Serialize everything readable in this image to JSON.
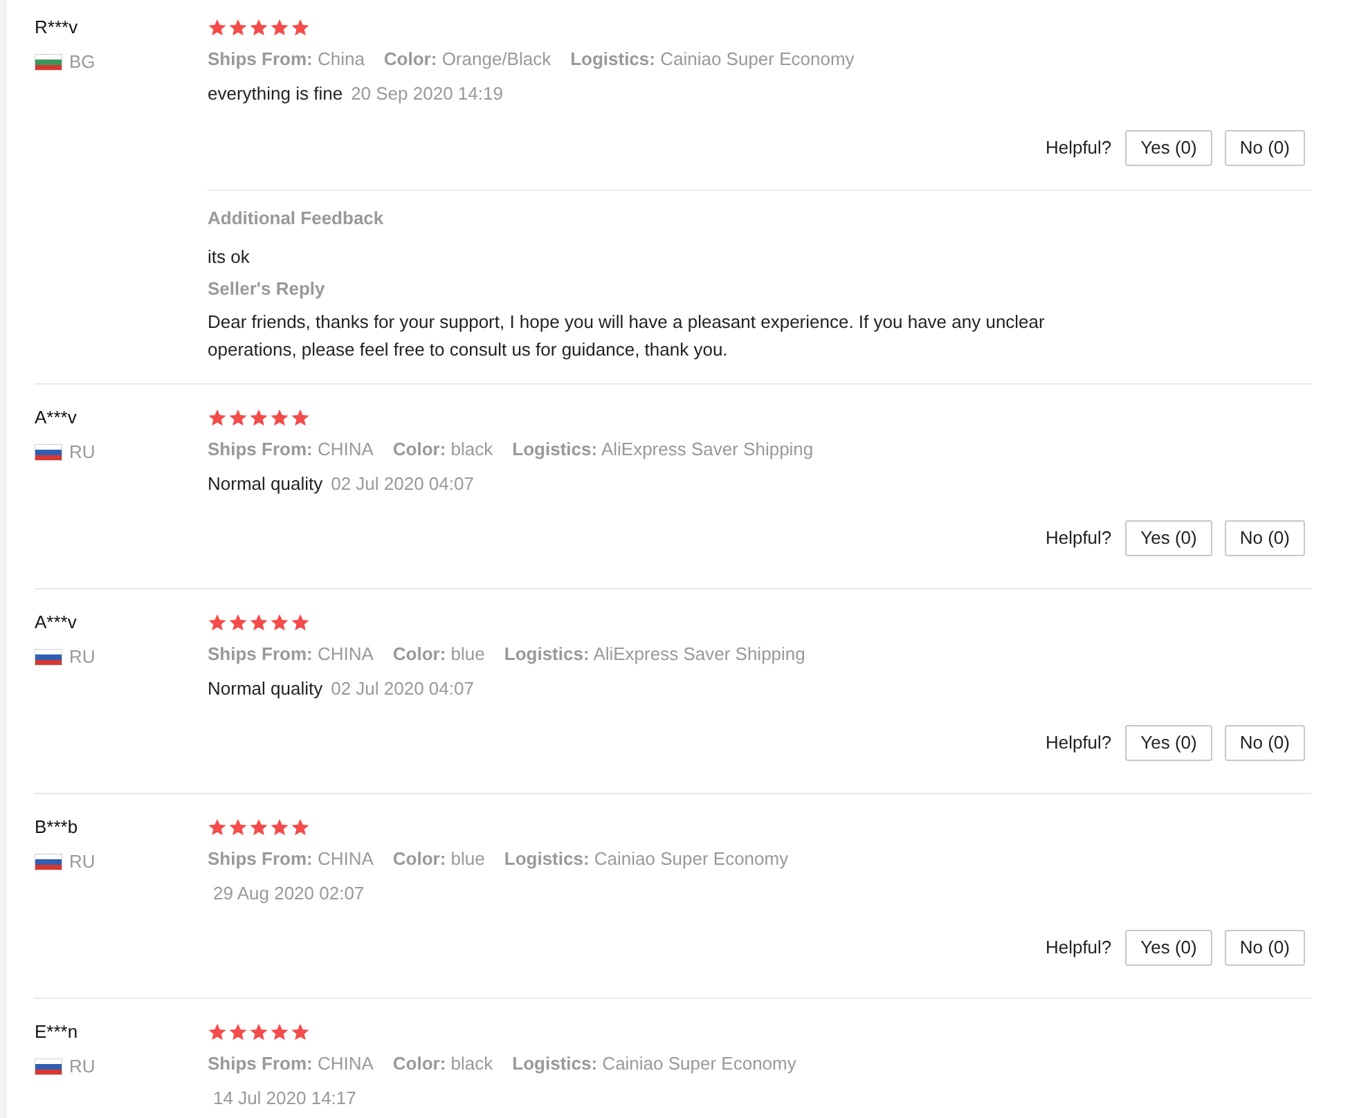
{
  "reviews": [
    {
      "user": "R***v",
      "flag": {
        "kind": "bg"
      },
      "country": "BG",
      "stars": 5,
      "attributes": [
        {
          "label": "Ships From:",
          "value": "China"
        },
        {
          "label": "Color:",
          "value": "Orange/Black"
        },
        {
          "label": "Logistics:",
          "value": "Cainiao Super Economy"
        }
      ],
      "comment": "everything is fine",
      "date": "20 Sep 2020 14:19",
      "helpful": {
        "label": "Helpful?",
        "yes": "Yes (0)",
        "no": "No (0)"
      },
      "additional": {
        "title": "Additional Feedback",
        "text": "its ok",
        "reply_title": "Seller's Reply",
        "reply": "Dear friends, thanks for your support, I hope you will have a pleasant experience. If you have any unclear operations, please feel free to consult us for guidance, thank you."
      }
    },
    {
      "user": "A***v",
      "flag": {
        "kind": "ru"
      },
      "country": "RU",
      "stars": 5,
      "attributes": [
        {
          "label": "Ships From:",
          "value": "CHINA"
        },
        {
          "label": "Color:",
          "value": "black"
        },
        {
          "label": "Logistics:",
          "value": "AliExpress Saver Shipping"
        }
      ],
      "comment": "Normal quality",
      "date": "02 Jul 2020 04:07",
      "helpful": {
        "label": "Helpful?",
        "yes": "Yes (0)",
        "no": "No (0)"
      }
    },
    {
      "user": "A***v",
      "flag": {
        "kind": "ru"
      },
      "country": "RU",
      "stars": 5,
      "attributes": [
        {
          "label": "Ships From:",
          "value": "CHINA"
        },
        {
          "label": "Color:",
          "value": "blue"
        },
        {
          "label": "Logistics:",
          "value": "AliExpress Saver Shipping"
        }
      ],
      "comment": "Normal quality",
      "date": "02 Jul 2020 04:07",
      "helpful": {
        "label": "Helpful?",
        "yes": "Yes (0)",
        "no": "No (0)"
      }
    },
    {
      "user": "B***b",
      "flag": {
        "kind": "ru"
      },
      "country": "RU",
      "stars": 5,
      "attributes": [
        {
          "label": "Ships From:",
          "value": "CHINA"
        },
        {
          "label": "Color:",
          "value": "blue"
        },
        {
          "label": "Logistics:",
          "value": "Cainiao Super Economy"
        }
      ],
      "date": "29 Aug 2020 02:07",
      "helpful": {
        "label": "Helpful?",
        "yes": "Yes (0)",
        "no": "No (0)"
      }
    },
    {
      "user": "E***n",
      "flag": {
        "kind": "ru"
      },
      "country": "RU",
      "stars": 5,
      "attributes": [
        {
          "label": "Ships From:",
          "value": "CHINA"
        },
        {
          "label": "Color:",
          "value": "black"
        },
        {
          "label": "Logistics:",
          "value": "Cainiao Super Economy"
        }
      ],
      "date": "14 Jul 2020 14:17"
    }
  ]
}
